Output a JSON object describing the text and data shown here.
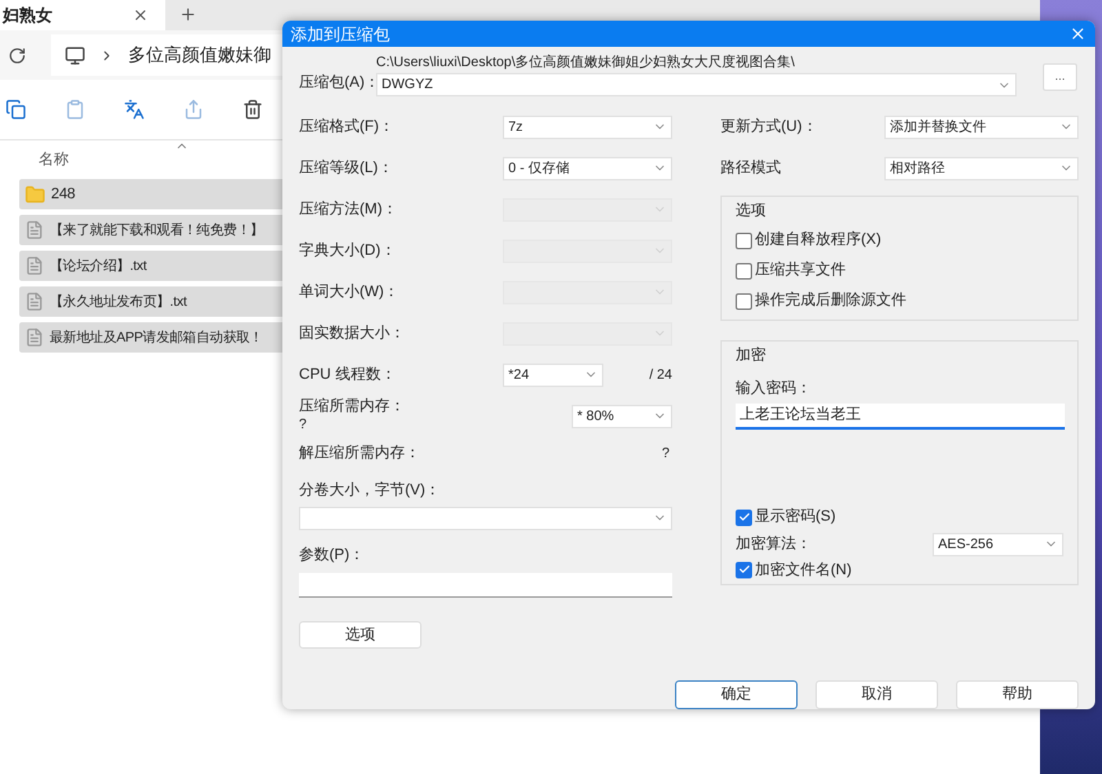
{
  "explorer": {
    "tab_title": "妇熟女",
    "breadcrumb": "多位高颜值嫩妹御",
    "column_header": "名称",
    "files": [
      {
        "kind": "folder",
        "name": "248"
      },
      {
        "kind": "text",
        "name": "【来了就能下载和观看！纯免费！】"
      },
      {
        "kind": "text",
        "name": "【论坛介绍】.txt"
      },
      {
        "kind": "text",
        "name": "【永久地址发布页】.txt"
      },
      {
        "kind": "text",
        "name": "最新地址及APP请发邮箱自动获取！"
      }
    ]
  },
  "dialog": {
    "title": "添加到压缩包",
    "archive": {
      "label": "压缩包(A)：",
      "path": "C:\\Users\\liuxi\\Desktop\\多位高颜值嫩妹御姐少妇熟女大尺度视图合集\\",
      "value": "DWGYZ",
      "browse": "..."
    },
    "left_fields": [
      {
        "label": "压缩格式(F)：",
        "value": "7z",
        "disabled": false
      },
      {
        "label": "压缩等级(L)：",
        "value": "0 - 仅存储",
        "disabled": false
      },
      {
        "label": "压缩方法(M)：",
        "disabled": true
      },
      {
        "label": "字典大小(D)：",
        "disabled": true
      },
      {
        "label": "单词大小(W)：",
        "disabled": true
      },
      {
        "label": "固实数据大小：",
        "disabled": true
      }
    ],
    "cpu": {
      "label": "CPU 线程数：",
      "value": "*24",
      "max": "/ 24"
    },
    "memory": {
      "label": "压缩所需内存：",
      "reading": "?",
      "value": "* 80%"
    },
    "unpack_memory": {
      "label": "解压缩所需内存：",
      "reading": "?"
    },
    "volume": {
      "label": "分卷大小，字节(V)："
    },
    "params": {
      "label": "参数(P)："
    },
    "options_button": "选项",
    "right_fields": [
      {
        "label": "更新方式(U)：",
        "value": "添加并替换文件"
      },
      {
        "label": "路径模式",
        "value": "相对路径"
      }
    ],
    "options_group": {
      "title": "选项",
      "checkboxes": [
        {
          "label": "创建自释放程序(X)",
          "checked": false
        },
        {
          "label": "压缩共享文件",
          "checked": false
        },
        {
          "label": "操作完成后删除源文件",
          "checked": false
        }
      ]
    },
    "encryption": {
      "title": "加密",
      "password_label": "输入密码：",
      "password": "上老王论坛当老王",
      "show_password": {
        "label": "显示密码(S)",
        "checked": true
      },
      "method_label": "加密算法：",
      "method": "AES-256",
      "encrypt_names": {
        "label": "加密文件名(N)",
        "checked": true
      }
    },
    "buttons": [
      {
        "label": "确定",
        "default": true
      },
      {
        "label": "取消",
        "default": false
      },
      {
        "label": "帮助",
        "default": false
      }
    ]
  }
}
